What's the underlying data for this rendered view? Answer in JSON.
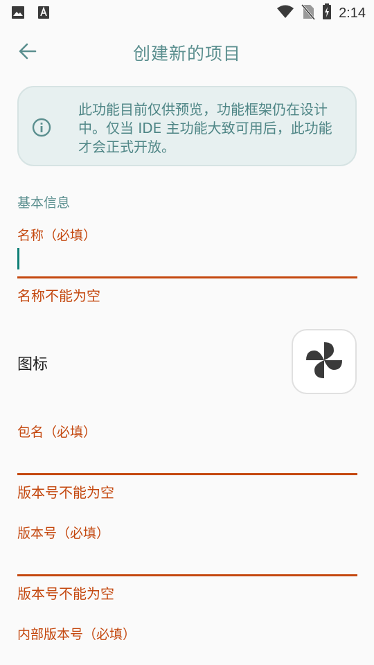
{
  "status_bar": {
    "time": "2:14",
    "icons": [
      "image-icon",
      "font-a-icon",
      "wifi-icon",
      "no-sim-icon",
      "battery-charging-icon"
    ]
  },
  "app_bar": {
    "title": "创建新的项目",
    "back_icon": "arrow-back-icon"
  },
  "notice": {
    "icon": "info-icon",
    "text": "此功能目前仅供预览，功能框架仍在设计中。仅当 IDE 主功能大致可用后，此功能才会正式开放。"
  },
  "form": {
    "section_basic": "基本信息",
    "name": {
      "label": "名称（必填）",
      "value": "",
      "error": "名称不能为空"
    },
    "icon": {
      "label": "图标",
      "icon": "pinwheel-icon"
    },
    "package": {
      "label": "包名（必填）",
      "value": "",
      "error": "版本号不能为空"
    },
    "version": {
      "label": "版本号（必填）",
      "value": "",
      "error": "版本号不能为空"
    },
    "internal_version": {
      "label": "内部版本号（必填）"
    }
  },
  "colors": {
    "accent": "#5b8f8f",
    "error": "#c4480f",
    "notice_bg": "#e7f0f0",
    "background": "#fafafa"
  }
}
